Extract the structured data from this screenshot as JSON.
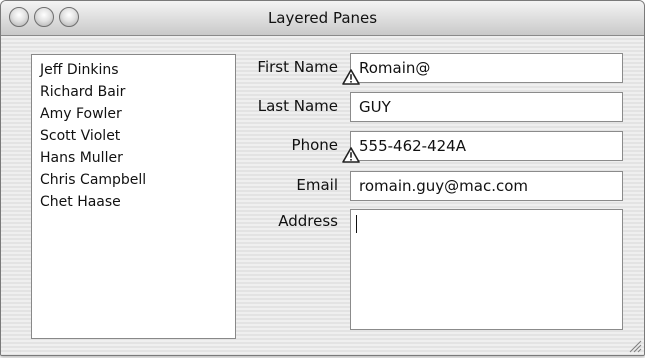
{
  "window": {
    "title": "Layered Panes"
  },
  "list": {
    "items": [
      "Jeff Dinkins",
      "Richard Bair",
      "Amy Fowler",
      "Scott Violet",
      "Hans Muller",
      "Chris Campbell",
      "Chet Haase"
    ]
  },
  "form": {
    "first_name": {
      "label": "First Name",
      "value": "Romain@"
    },
    "last_name": {
      "label": "Last Name",
      "value": "GUY"
    },
    "phone": {
      "label": "Phone",
      "value": "555-462-424A"
    },
    "email": {
      "label": "Email",
      "value": "romain.guy@mac.com"
    },
    "address": {
      "label": "Address",
      "value": ""
    }
  },
  "icons": {
    "warning": "warning-icon",
    "resize": "resize-grip-icon"
  }
}
